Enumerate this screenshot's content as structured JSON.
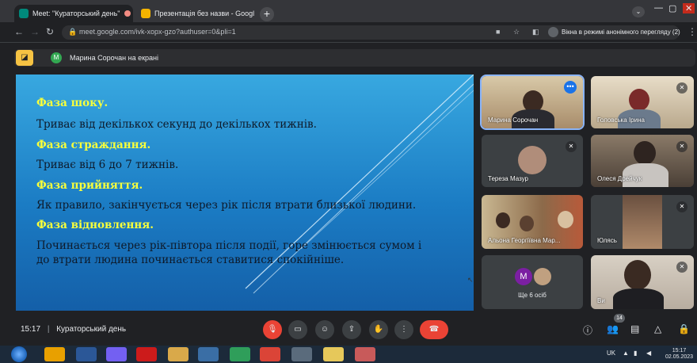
{
  "browser": {
    "tabs": [
      {
        "title": "Meet: \"Кураторський день\"",
        "active": true,
        "recording": true
      },
      {
        "title": "Презентація без назви - Googl",
        "active": false,
        "recording": false
      }
    ],
    "url": "meet.google.com/ivk-xopx-gzo?authuser=0&pli=1",
    "incognito_label": "Вікна в режимі анонімного перегляду (2)"
  },
  "banner": {
    "avatar_letter": "М",
    "text": "Марина Сорочан на екрані"
  },
  "slide": {
    "lines": [
      {
        "kind": "head",
        "text": "Фаза шоку."
      },
      {
        "kind": "body",
        "text": "Триває від декількох секунд до декількох тижнів."
      },
      {
        "kind": "head",
        "text": "Фаза страждання."
      },
      {
        "kind": "body",
        "text": "Триває від 6 до 7 тижнів."
      },
      {
        "kind": "head",
        "text": "Фаза прийняття."
      },
      {
        "kind": "body",
        "text": "Як правило, закінчується через рік після втрати близької людини."
      },
      {
        "kind": "head",
        "text": "Фаза відновлення."
      },
      {
        "kind": "body",
        "text": "Починається через рік-півтора після події, горе змінюється сумом і"
      },
      {
        "kind": "body",
        "text": "до втрати людина починається ставитися спокійніше."
      }
    ]
  },
  "participants": [
    {
      "name": "Марина Сорочан",
      "muted": false,
      "speaking": true
    },
    {
      "name": "Головська Ірина",
      "muted": true,
      "speaking": false
    },
    {
      "name": "Тереза Мазур",
      "muted": true,
      "speaking": false
    },
    {
      "name": "Олеся Дрейчук",
      "muted": true,
      "speaking": false
    },
    {
      "name": "Альона Георгіївна Мар...",
      "muted": false,
      "speaking": false
    },
    {
      "name": "Юлясь",
      "muted": true,
      "speaking": false
    },
    {
      "name": "Ще 6 осіб",
      "muted": false,
      "speaking": false,
      "avatar_letter": "М"
    },
    {
      "name": "Ви",
      "muted": true,
      "speaking": false
    }
  ],
  "meeting": {
    "time": "15:17",
    "title": "Кураторський день",
    "people_count": "14"
  },
  "taskbar": {
    "lang": "UK",
    "time": "15:17",
    "date": "02.05.2023"
  },
  "colors": {
    "hangup": "#ea4335",
    "accent": "#8ab4f8",
    "slide_heading": "#f7ff3c"
  }
}
